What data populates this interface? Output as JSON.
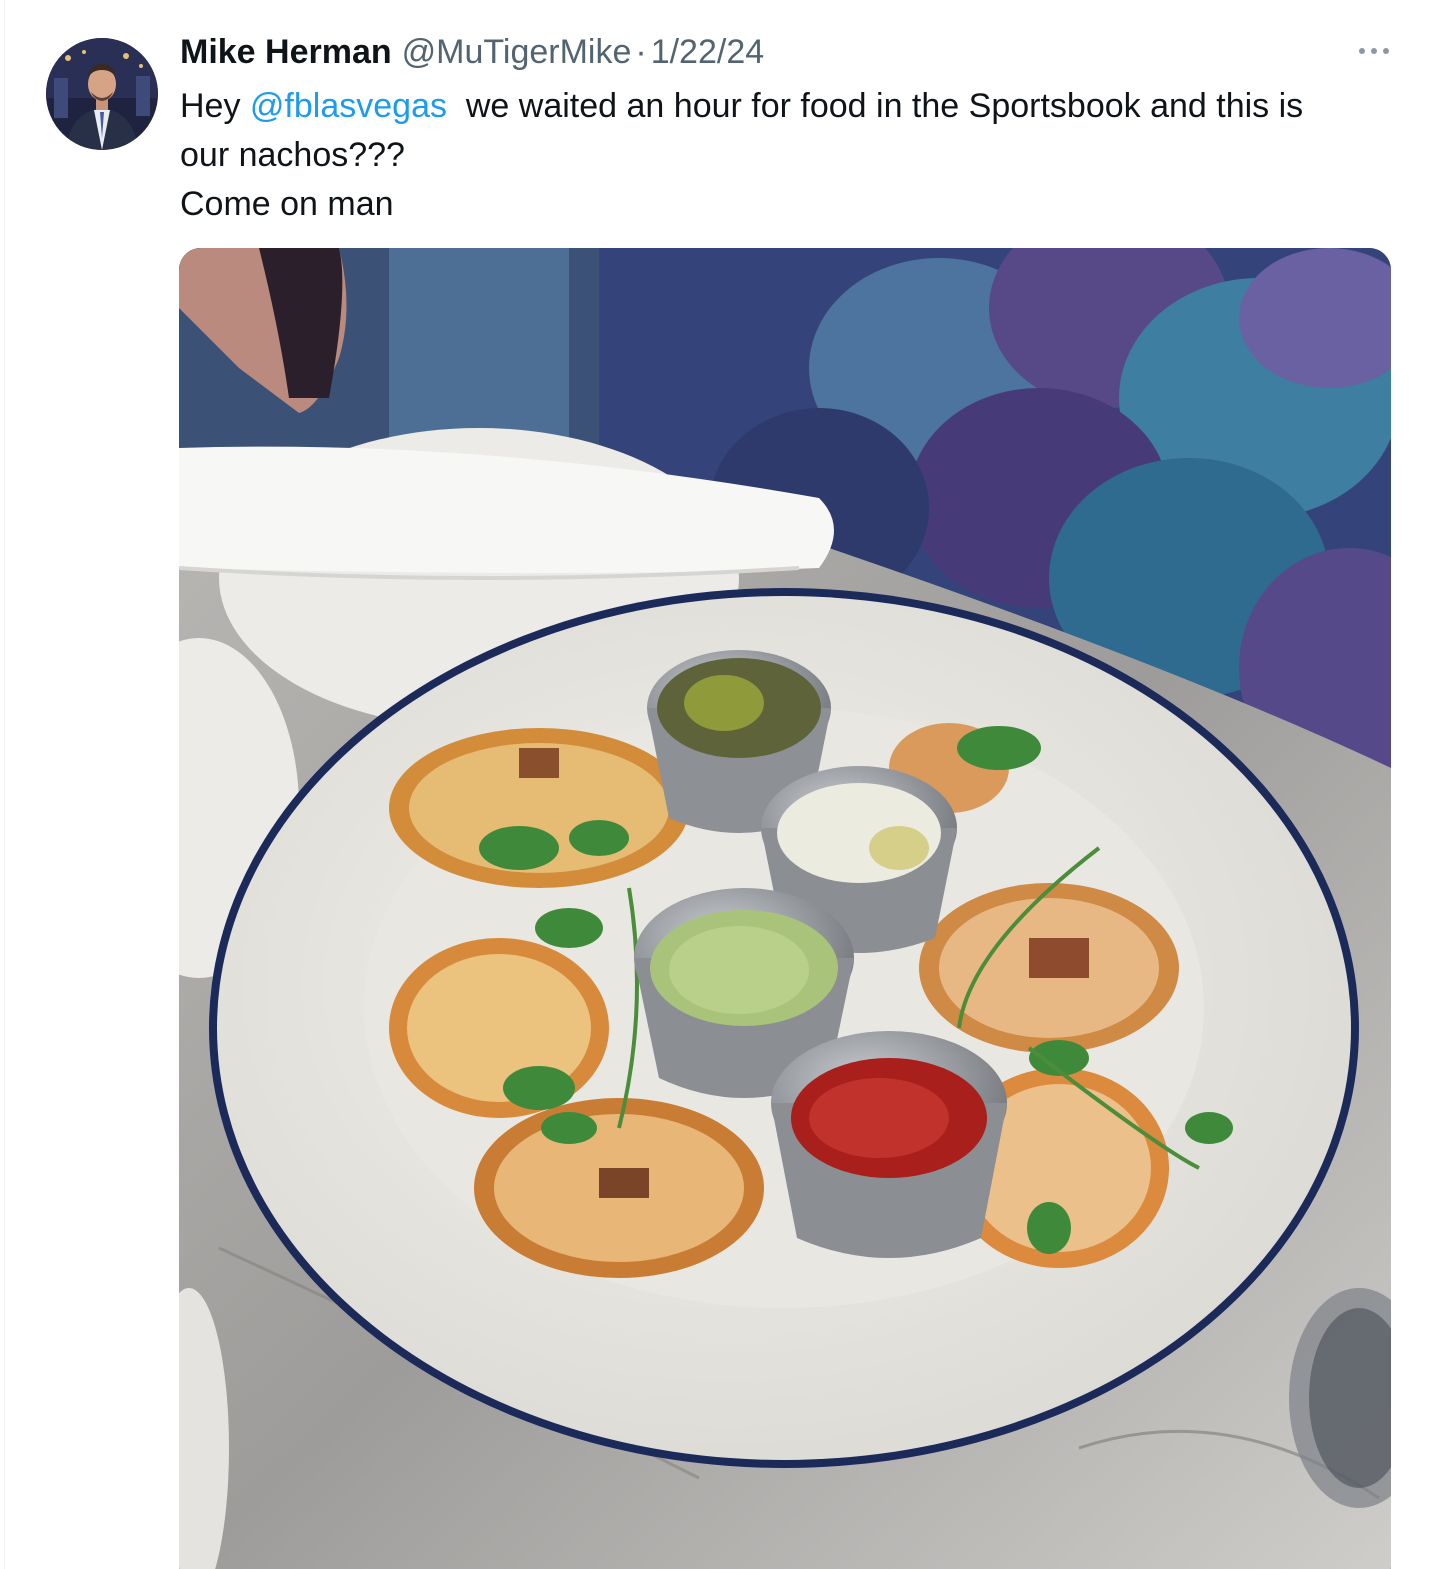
{
  "tweet": {
    "display_name": "Mike Herman",
    "handle": "@MuTigerMike",
    "separator": "·",
    "date": "1/22/24",
    "text_line1_before": "Hey ",
    "mention": "@fblasvegas",
    "text_line1_after": "  we waited an hour for food in the Sportsbook and this is",
    "text_line2": "our nachos???",
    "text_line3": "Come on man"
  },
  "icons": {
    "more": "more-horizontal-icon",
    "avatar": "profile-photo"
  },
  "colors": {
    "name": "#0f1419",
    "secondary": "#536471",
    "link": "#1d9bf0"
  }
}
